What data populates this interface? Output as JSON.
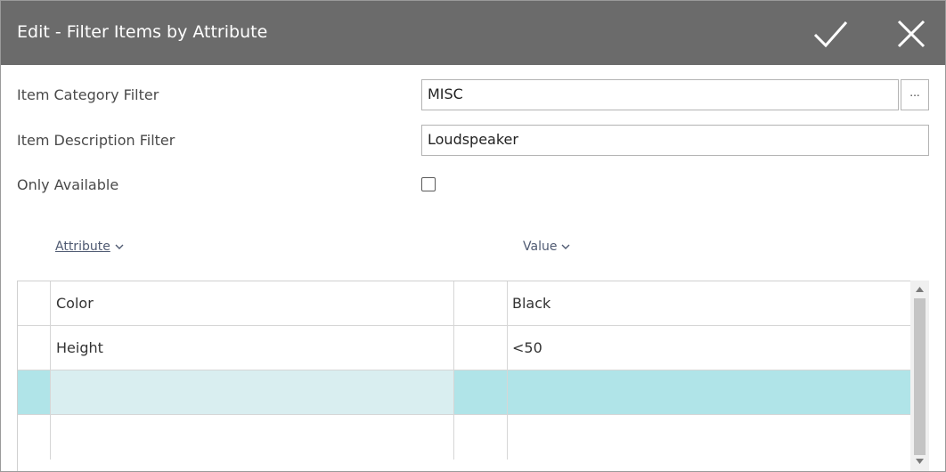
{
  "dialog": {
    "title": "Edit - Filter Items by Attribute",
    "ok_icon": "checkmark-icon",
    "close_icon": "close-icon"
  },
  "fields": {
    "category": {
      "label": "Item Category Filter",
      "value": "MISC",
      "lookup_label": "..."
    },
    "description": {
      "label": "Item Description Filter",
      "value": "Loudspeaker"
    },
    "only_available": {
      "label": "Only Available",
      "checked": false
    }
  },
  "grid": {
    "columns": {
      "attribute": "Attribute",
      "value": "Value"
    },
    "rows": [
      {
        "attribute": "Color",
        "value": "Black"
      },
      {
        "attribute": "Height",
        "value": "<50"
      },
      {
        "attribute": "",
        "value": ""
      },
      {
        "attribute": "",
        "value": ""
      }
    ],
    "active_row_index": 2
  },
  "colors": {
    "titlebar": "#6b6b6b",
    "active_row": "#b0e4e8",
    "header_link": "#4f5a72"
  }
}
